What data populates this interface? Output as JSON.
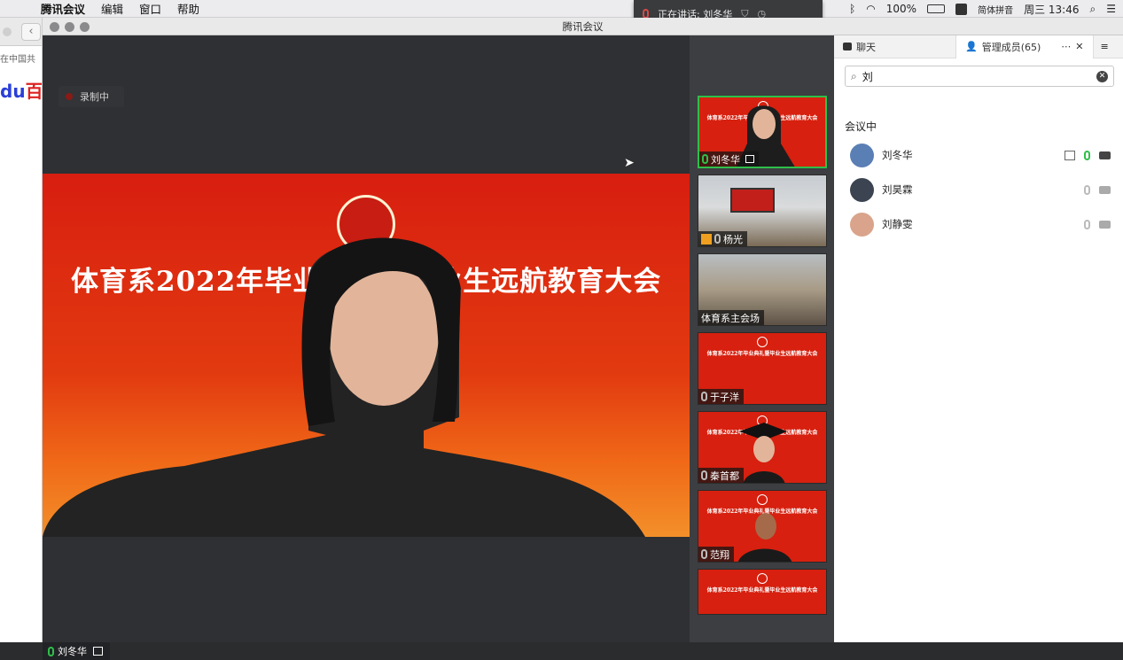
{
  "menubar": {
    "app_name": "腾讯会议",
    "items": [
      "编辑",
      "窗口",
      "帮助"
    ],
    "battery": "100%",
    "input_method": "简体拼音",
    "datetime": "周三 13:46"
  },
  "speaking_popup": {
    "text": "正在讲话: 刘冬华"
  },
  "browser": {
    "snippet": "在中国共",
    "logo": "百"
  },
  "window": {
    "title": "腾讯会议"
  },
  "main_video": {
    "recording_label": "录制中",
    "banner": "体育系2022年毕业典礼暨毕业生远航教育大会",
    "speaker_name": "刘冬华"
  },
  "thumbnails": [
    {
      "name": "刘冬华",
      "mic": "on"
    },
    {
      "name": "杨光",
      "mic": "off"
    },
    {
      "name": "体育系主会场",
      "mic": "none"
    },
    {
      "name": "于子洋",
      "mic": "off"
    },
    {
      "name": "秦首都",
      "mic": "off"
    },
    {
      "name": "范翔",
      "mic": "off"
    },
    {
      "name": "",
      "mic": "none"
    }
  ],
  "thumbnail_banner": "体育系2022年毕业典礼暨毕业生远航教育大会",
  "panel": {
    "tab_chat": "聊天",
    "tab_members": "管理成员(65)",
    "search_value": "刘",
    "section_title": "会议中",
    "members": [
      {
        "name": "刘冬华",
        "mic": "on",
        "camera": "on",
        "avatar_color": "#5a7fb5"
      },
      {
        "name": "刘昊霖",
        "mic": "off",
        "camera": "off",
        "avatar_color": "#3b4450"
      },
      {
        "name": "刘静雯",
        "mic": "off",
        "camera": "off",
        "avatar_color": "#d9a48b"
      }
    ]
  },
  "colors": {
    "accent_green": "#2fbf4a",
    "stage_red": "#d81e10"
  }
}
